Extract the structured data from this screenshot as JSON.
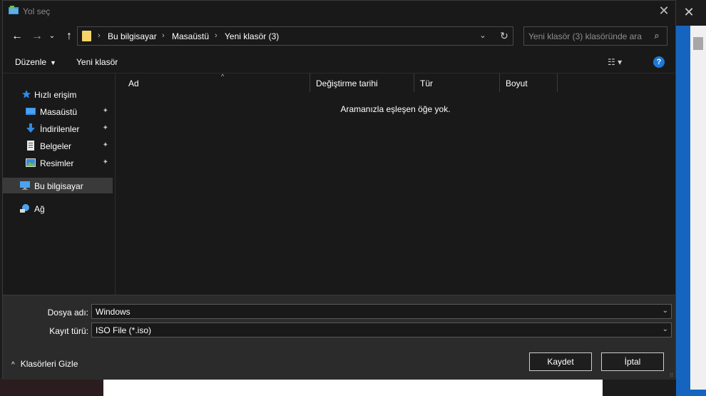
{
  "window": {
    "title": "Yol seç",
    "close_glyph": "✕"
  },
  "background": {
    "close_glyph": "✕"
  },
  "navigation": {
    "back_glyph": "←",
    "forward_glyph": "→",
    "recent_glyph": "⌄",
    "up_glyph": "↑",
    "breadcrumbs": [
      "Bu bilgisayar",
      "Masaüstü",
      "Yeni klasör (3)"
    ],
    "separator": "›",
    "dropdown_glyph": "⌄",
    "refresh_glyph": "↻"
  },
  "search": {
    "placeholder": "Yeni klasör (3) klasöründe ara",
    "icon": "⌕"
  },
  "toolbar": {
    "organize_label": "Düzenle",
    "organize_caret": "▼",
    "new_folder_label": "Yeni klasör",
    "view_glyph": "☷ ▾",
    "help_glyph": "?"
  },
  "sidebar": {
    "items": [
      {
        "label": "Hızlı erişim",
        "icon": "star-icon",
        "pinned": false
      },
      {
        "label": "Masaüstü",
        "icon": "desktop-icon",
        "pinned": true
      },
      {
        "label": "İndirilenler",
        "icon": "download-icon",
        "pinned": true
      },
      {
        "label": "Belgeler",
        "icon": "document-icon",
        "pinned": true
      },
      {
        "label": "Resimler",
        "icon": "pictures-icon",
        "pinned": true
      },
      {
        "label": "Bu bilgisayar",
        "icon": "computer-icon",
        "pinned": false,
        "selected": true
      },
      {
        "label": "Ağ",
        "icon": "network-icon",
        "pinned": false
      }
    ],
    "pin_glyph": "✦"
  },
  "content": {
    "columns": [
      "Ad",
      "Değiştirme tarihi",
      "Tür",
      "Boyut"
    ],
    "sort_glyph": "^",
    "empty_message": "Aramanızla eşleşen öğe yok."
  },
  "form": {
    "filename_label": "Dosya adı:",
    "filename_value": "Windows",
    "filetype_label": "Kayıt türü:",
    "filetype_value": "ISO File (*.iso)",
    "caret": "⌄",
    "hide_folders_label": "Klasörleri Gizle",
    "hide_folders_chevron": "^",
    "save_label": "Kaydet",
    "cancel_label": "İptal",
    "grip_glyph": "⁝⁝"
  },
  "colors": {
    "accent": "#1e78d6",
    "folder": "#f5d36b",
    "selected_bg": "#3a3a3a"
  }
}
